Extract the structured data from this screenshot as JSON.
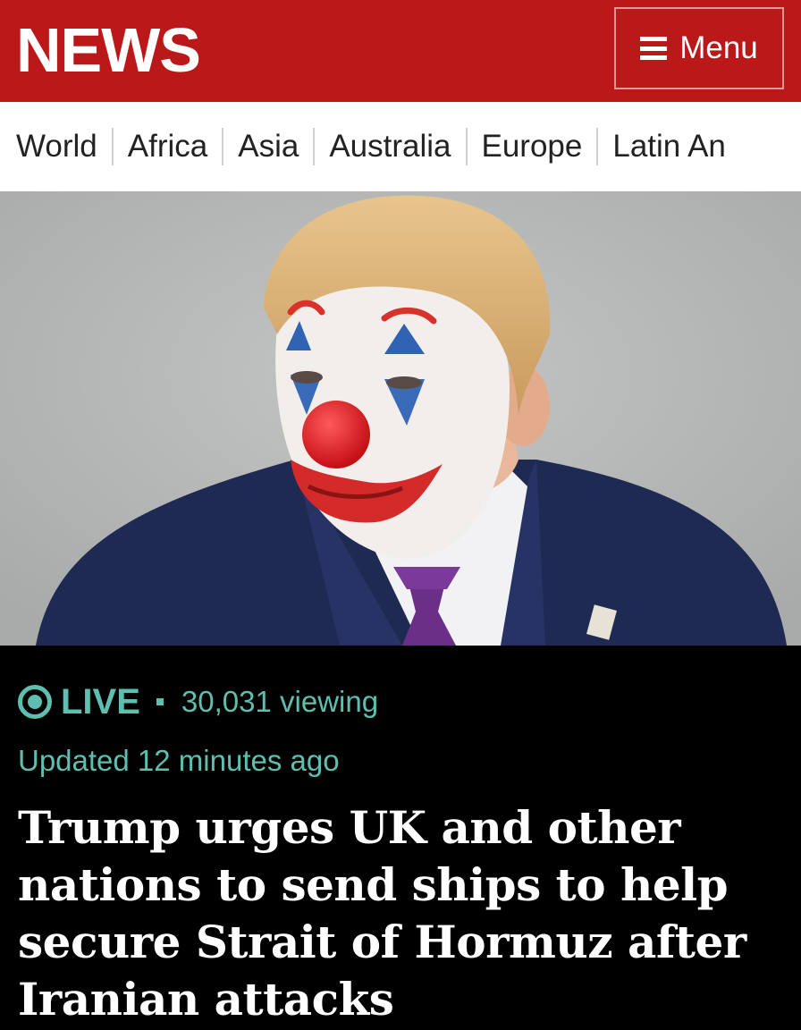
{
  "header": {
    "logo": "NEWS",
    "menu_label": "Menu",
    "brand_color": "#bb1919"
  },
  "nav": {
    "items": [
      "World",
      "Africa",
      "Asia",
      "Australia",
      "Europe",
      "Latin An"
    ]
  },
  "hero": {
    "image_alt": "Photo of a man in a dark suit with clown face paint and a red nose"
  },
  "article": {
    "live_label": "LIVE",
    "viewers": "30,031 viewing",
    "updated": "Updated 12 minutes ago",
    "headline": "Trump urges UK and other nations to send ships to help secure Strait of Hormuz after Iranian attacks",
    "accent_color": "#5ebfb0"
  }
}
